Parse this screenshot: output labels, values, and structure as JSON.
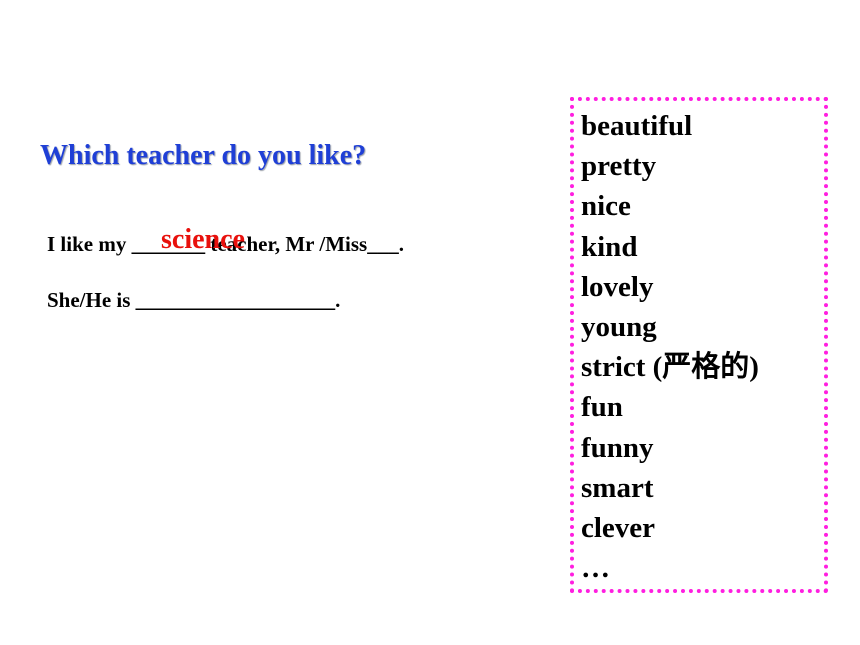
{
  "question": "Which teacher do you like?",
  "sentence1": "I like my _______ teacher,  Mr /Miss___.",
  "sentence2": "She/He is ___________________.",
  "filled_answer": "science",
  "words": [
    "beautiful",
    "pretty",
    "nice",
    "kind",
    "lovely",
    "young",
    "strict (严格的)",
    "fun",
    "funny",
    "smart",
    "clever",
    "…"
  ],
  "colors": {
    "question": "#1f3fd6",
    "answer": "#e8100c",
    "box_border": "#ff1fe0"
  }
}
